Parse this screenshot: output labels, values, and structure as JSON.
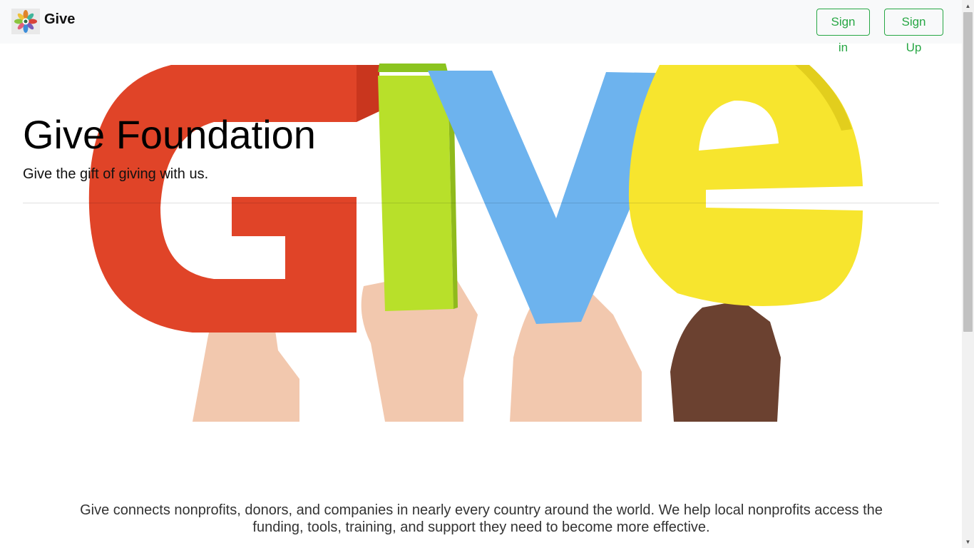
{
  "navbar": {
    "brand_name": "Give",
    "logo_icon": "flower-logo-icon",
    "sign_in_label": "Sign in",
    "sign_up_label": "Sign Up",
    "accent_color": "#28a745"
  },
  "hero": {
    "title": "Give Foundation",
    "subtitle": "Give the gift of giving with us.",
    "image": "hands-holding-colorful-give-letters",
    "letter_colors": [
      "#e04428",
      "#b8e02a",
      "#6db3ee",
      "#f7e52e"
    ]
  },
  "about": {
    "text": "Give connects nonprofits, donors, and companies in nearly every country around the world. We help local nonprofits access the funding, tools, training, and support they need to become more effective."
  },
  "scrollbar": {
    "up_icon": "scroll-up-arrow-icon",
    "down_icon": "scroll-down-arrow-icon"
  }
}
